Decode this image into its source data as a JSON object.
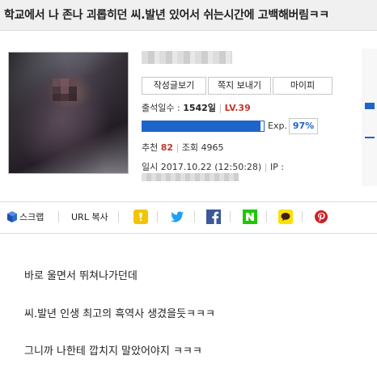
{
  "post": {
    "title": "학교에서 나 존나 괴롭히던 씨.발년 있어서 쉬는시간에 고백해버림ㅋㅋ"
  },
  "profile": {
    "buttons": {
      "posts": "작성글보기",
      "message": "쪽지 보내기",
      "mypage": "마이피"
    },
    "attendance_label": "출석일수 :",
    "attendance_value": "1542일",
    "level": "LV.39",
    "exp_label": "Exp.",
    "exp_percent": "97%",
    "exp_fraction": 0.97,
    "recommend_label": "추천",
    "recommend_value": "82",
    "views_label": "조회",
    "views_value": "4965",
    "date_label": "일시",
    "date_value": "2017.10.22 (12:50:28)",
    "ip_label": "IP :"
  },
  "share": {
    "scrap": "스크랩",
    "url_copy": "URL 복사"
  },
  "body": {
    "lines": [
      "바로 울면서 뛰쳐나가던데",
      "씨.발년 인생 최고의 흑역사 생겼을듯ㅋㅋㅋ",
      "그니까 나한테 깝치지 말았어야지 ㅋㅋㅋ"
    ]
  },
  "colors": {
    "accent": "#1f64c8",
    "level": "#c0392b",
    "kakaostory": "#f2c500",
    "twitter": "#1da1f2",
    "facebook": "#3b5998",
    "naver": "#1ec800",
    "kakaotalk": "#fae100",
    "pinterest": "#cb2027"
  },
  "icons": {
    "scrap": "scrap-cube-icon",
    "kakaostory": "kakaostory-icon",
    "twitter": "twitter-icon",
    "facebook": "facebook-icon",
    "naver": "naver-icon",
    "kakaotalk": "kakaotalk-icon",
    "pinterest": "pinterest-icon"
  }
}
